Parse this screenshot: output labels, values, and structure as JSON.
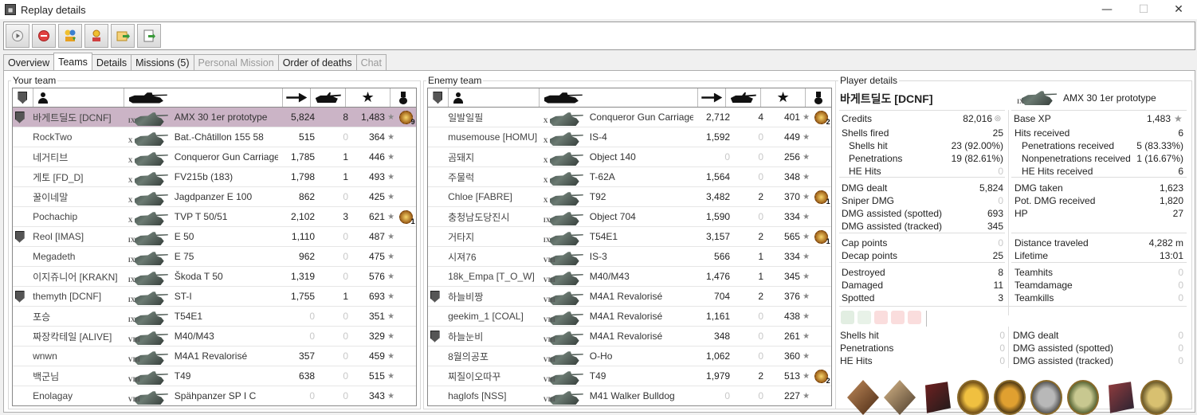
{
  "window": {
    "title": "Replay details",
    "minimize": "—",
    "maximize": "☐",
    "close": "✕"
  },
  "toolbar": {
    "buttons": [
      "play-icon",
      "stop-icon",
      "medals-icon",
      "medals-alt-icon",
      "export-icon",
      "export-alt-icon"
    ]
  },
  "tabs": [
    {
      "label": "Overview",
      "state": "normal"
    },
    {
      "label": "Teams",
      "state": "active"
    },
    {
      "label": "Details",
      "state": "normal"
    },
    {
      "label": "Missions (5)",
      "state": "normal"
    },
    {
      "label": "Personal Mission",
      "state": "disabled"
    },
    {
      "label": "Order of deaths",
      "state": "normal"
    },
    {
      "label": "Chat",
      "state": "disabled"
    }
  ],
  "your_team": {
    "label": "Your team",
    "rows": [
      {
        "name": "바게트딜도 [DCNF]",
        "badge": true,
        "tier": "IX",
        "tank": "AMX 30 1er prototype",
        "dmg": "5,824",
        "kills": "8",
        "xp": "1,483",
        "medal": "9",
        "selected": true
      },
      {
        "name": "RockTwo",
        "badge": false,
        "tier": "X",
        "tank": "Bat.-Châtillon 155 58",
        "dmg": "515",
        "kills": "0",
        "xp": "364",
        "medal": ""
      },
      {
        "name": "네거티브",
        "badge": false,
        "tier": "X",
        "tank": "Conqueror Gun Carriage",
        "dmg": "1,785",
        "kills": "1",
        "xp": "446",
        "medal": ""
      },
      {
        "name": "게토 [FD_D]",
        "badge": false,
        "tier": "X",
        "tank": "FV215b (183)",
        "dmg": "1,798",
        "kills": "1",
        "xp": "493",
        "medal": ""
      },
      {
        "name": "꿀이네말",
        "badge": false,
        "tier": "X",
        "tank": "Jagdpanzer E 100",
        "dmg": "862",
        "kills": "0",
        "xp": "425",
        "medal": ""
      },
      {
        "name": "Pochachip",
        "badge": false,
        "tier": "X",
        "tank": "TVP T 50/51",
        "dmg": "2,102",
        "kills": "3",
        "xp": "621",
        "medal": "1"
      },
      {
        "name": "Reol [IMAS]",
        "badge": true,
        "tier": "IX",
        "tank": "E 50",
        "dmg": "1,110",
        "kills": "0",
        "xp": "487",
        "medal": ""
      },
      {
        "name": "Megadeth",
        "badge": false,
        "tier": "IX",
        "tank": "E 75",
        "dmg": "962",
        "kills": "0",
        "xp": "475",
        "medal": ""
      },
      {
        "name": "이지쥬니어 [KRAKN]",
        "badge": false,
        "tier": "IX",
        "tank": "Škoda T 50",
        "dmg": "1,319",
        "kills": "0",
        "xp": "576",
        "medal": ""
      },
      {
        "name": "themyth [DCNF]",
        "badge": true,
        "tier": "IX",
        "tank": "ST-I",
        "dmg": "1,755",
        "kills": "1",
        "xp": "693",
        "medal": ""
      },
      {
        "name": "포승",
        "badge": false,
        "tier": "IX",
        "tank": "T54E1",
        "dmg": "0",
        "kills": "0",
        "xp": "351",
        "medal": ""
      },
      {
        "name": "짜장칵테일 [ALIVE]",
        "badge": false,
        "tier": "VIII",
        "tank": "M40/M43",
        "dmg": "0",
        "kills": "0",
        "xp": "329",
        "medal": ""
      },
      {
        "name": "wnwn",
        "badge": false,
        "tier": "VIII",
        "tank": "M4A1 Revalorisé",
        "dmg": "357",
        "kills": "0",
        "xp": "459",
        "medal": ""
      },
      {
        "name": "백군님",
        "badge": false,
        "tier": "VIII",
        "tank": "T49",
        "dmg": "638",
        "kills": "0",
        "xp": "515",
        "medal": ""
      },
      {
        "name": "Enolagay",
        "badge": false,
        "tier": "VIII",
        "tank": "Spähpanzer SP I C",
        "dmg": "0",
        "kills": "0",
        "xp": "343",
        "medal": ""
      }
    ]
  },
  "enemy_team": {
    "label": "Enemy team",
    "rows": [
      {
        "name": "일발일필",
        "badge": false,
        "tier": "X",
        "tank": "Conqueror Gun Carriage",
        "dmg": "2,712",
        "kills": "4",
        "xp": "401",
        "medal": "2"
      },
      {
        "name": "musemouse [HOMU]",
        "badge": false,
        "tier": "X",
        "tank": "IS-4",
        "dmg": "1,592",
        "kills": "0",
        "xp": "449",
        "medal": ""
      },
      {
        "name": "곰돼지",
        "badge": false,
        "tier": "X",
        "tank": "Object 140",
        "dmg": "0",
        "kills": "0",
        "xp": "256",
        "medal": ""
      },
      {
        "name": "주물럭",
        "badge": false,
        "tier": "X",
        "tank": "T-62A",
        "dmg": "1,564",
        "kills": "0",
        "xp": "348",
        "medal": ""
      },
      {
        "name": "Chloe [FABRE]",
        "badge": false,
        "tier": "X",
        "tank": "T92",
        "dmg": "3,482",
        "kills": "2",
        "xp": "370",
        "medal": "1"
      },
      {
        "name": "충청남도당진시",
        "badge": false,
        "tier": "IX",
        "tank": "Object 704",
        "dmg": "1,590",
        "kills": "0",
        "xp": "334",
        "medal": ""
      },
      {
        "name": "거타지",
        "badge": false,
        "tier": "IX",
        "tank": "T54E1",
        "dmg": "3,157",
        "kills": "2",
        "xp": "565",
        "medal": "1"
      },
      {
        "name": "시져76",
        "badge": false,
        "tier": "VIII",
        "tank": "IS-3",
        "dmg": "566",
        "kills": "1",
        "xp": "334",
        "medal": ""
      },
      {
        "name": "18k_Empa [T_O_W]",
        "badge": false,
        "tier": "VIII",
        "tank": "M40/M43",
        "dmg": "1,476",
        "kills": "1",
        "xp": "345",
        "medal": ""
      },
      {
        "name": "하늘비짱",
        "badge": true,
        "tier": "VIII",
        "tank": "M4A1 Revalorisé",
        "dmg": "704",
        "kills": "2",
        "xp": "376",
        "medal": ""
      },
      {
        "name": "geekim_1 [COAL]",
        "badge": false,
        "tier": "VIII",
        "tank": "M4A1 Revalorisé",
        "dmg": "1,161",
        "kills": "0",
        "xp": "438",
        "medal": ""
      },
      {
        "name": "하늘눈비",
        "badge": true,
        "tier": "VIII",
        "tank": "M4A1 Revalorisé",
        "dmg": "348",
        "kills": "0",
        "xp": "261",
        "medal": ""
      },
      {
        "name": "8월의공포",
        "badge": false,
        "tier": "VIII",
        "tank": "O-Ho",
        "dmg": "1,062",
        "kills": "0",
        "xp": "360",
        "medal": ""
      },
      {
        "name": "찌질이오따꾸",
        "badge": false,
        "tier": "VIII",
        "tank": "T49",
        "dmg": "1,979",
        "kills": "2",
        "xp": "513",
        "medal": "2"
      },
      {
        "name": "haglofs [NSS]",
        "badge": false,
        "tier": "VIII",
        "tank": "M41 Walker Bulldog",
        "dmg": "0",
        "kills": "0",
        "xp": "227",
        "medal": ""
      }
    ]
  },
  "player": {
    "label": "Player details",
    "name": "바게트딜도 [DCNF]",
    "tier": "IX",
    "tank": "AMX 30 1er prototype",
    "credits_label": "Credits",
    "credits": "82,016",
    "basexp_label": "Base XP",
    "basexp": "1,483",
    "left": [
      {
        "label": "Shells fired",
        "value": "25"
      },
      {
        "label": "Shells hit",
        "value": "23 (92.00%)"
      },
      {
        "label": "Penetrations",
        "value": "19 (82.61%)"
      },
      {
        "label": "HE Hits",
        "value": "0"
      },
      {
        "label": "DMG dealt",
        "value": "5,824"
      },
      {
        "label": "Sniper DMG",
        "value": "0"
      },
      {
        "label": "DMG assisted (spotted)",
        "value": "693"
      },
      {
        "label": "DMG assisted (tracked)",
        "value": "345"
      },
      {
        "label": "Cap points",
        "value": "0"
      },
      {
        "label": "Decap points",
        "value": "25"
      },
      {
        "label": "Destroyed",
        "value": "8"
      },
      {
        "label": "Damaged",
        "value": "11"
      },
      {
        "label": "Spotted",
        "value": "3"
      }
    ],
    "right": [
      {
        "label": "Hits received",
        "value": "6"
      },
      {
        "label": "Penetrations received",
        "value": "5 (83.33%)"
      },
      {
        "label": "Nonpenetrations received",
        "value": "1 (16.67%)"
      },
      {
        "label": "HE Hits received",
        "value": "6"
      },
      {
        "label": "DMG taken",
        "value": "1,623"
      },
      {
        "label": "Pot. DMG received",
        "value": "1,820"
      },
      {
        "label": "HP",
        "value": "27"
      },
      {
        "label": "Distance traveled",
        "value": "4,282 m"
      },
      {
        "label": "Lifetime",
        "value": "13:01"
      },
      {
        "label": "Teamhits",
        "value": "0"
      },
      {
        "label": "Teamdamage",
        "value": "0"
      },
      {
        "label": "Teamkills",
        "value": "0"
      }
    ],
    "bottom_left": [
      {
        "label": "Shells hit",
        "value": "0"
      },
      {
        "label": "Penetrations",
        "value": "0"
      },
      {
        "label": "HE Hits",
        "value": "0"
      }
    ],
    "bottom_right": [
      {
        "label": "DMG dealt",
        "value": "0"
      },
      {
        "label": "DMG assisted (spotted)",
        "value": "0"
      },
      {
        "label": "DMG assisted (tracked)",
        "value": "0"
      }
    ],
    "achievements": [
      "achievement-1-icon",
      "achievement-2-icon",
      "achievement-3-icon",
      "achievement-4-icon",
      "achievement-5-icon",
      "achievement-6-icon",
      "achievement-7-icon",
      "achievement-8-icon",
      "achievement-9-icon"
    ]
  },
  "colors": {
    "selected_row": "#cbb4c6",
    "zero_value": "#c8c8c8"
  }
}
